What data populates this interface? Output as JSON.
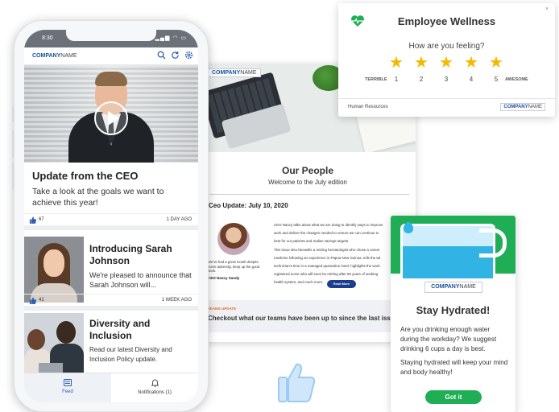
{
  "brand": {
    "logo_bold": "COMPANY",
    "logo_light": "NAME"
  },
  "phone": {
    "status_time": "8:30",
    "status_icons": "▂▄▆ ◠ ▭",
    "feed": [
      {
        "title": "Update from the CEO",
        "subtitle": "Take a look at the goals we want to achieve this year!",
        "likes": "67",
        "ago": "1 DAY AGO"
      },
      {
        "title": "Introducing Sarah Johnson",
        "subtitle": "We're pleased to announce that Sarah Johnson will...",
        "likes": "41",
        "ago": "1 WEEK AGO"
      },
      {
        "title": "Diversity and Inclusion",
        "subtitle": "Read our latest Diversity and Inclusion Policy update."
      }
    ],
    "tabs": {
      "feed": "Feed",
      "notifications": "Notifications (1)"
    }
  },
  "newsletter": {
    "title": "Our People",
    "subtitle": "Welcome to the July edition",
    "date": "Ceo Update: July 10, 2020",
    "quote": "We've had a great month despite some adversity, keep up the good work.",
    "ceo": "CEO Nancy Sandy",
    "body": [
      "CEO Nancy talks about what we are doing to identify ways to improve",
      "work and deliver the changes needed to ensure we can continue to",
      "best for our patients and realise savings targets.",
      "This issue also farewells a retiring hematologist who chose a career",
      "medicine following an experience in Papua New Guinea, tells the tal",
      "technician's time in a managed quarantine hotel, highlights the work",
      "registered nurse who will soon be retiring after 50 years of working",
      "health system, and much more."
    ],
    "read_more": "Read More",
    "team_label": "TEAMS UPDATE",
    "team_text": "Checkout what our teams have been up to since the last issue"
  },
  "wellness": {
    "title": "Employee Wellness",
    "close": "×",
    "question": "How are you feeling?",
    "rating_scale": [
      1,
      2,
      3,
      4,
      5
    ],
    "low_label": "TERRIBLE",
    "high_label": "AWESOME",
    "footer_left": "Human Resources"
  },
  "hydration": {
    "title": "Stay Hydrated!",
    "text1": "Are you drinking enough water during the workday? We suggest drinking 6 cups a day is best.",
    "text2": "Staying hydrated will keep your mind and body healthy!",
    "button": "Got it"
  },
  "colors": {
    "brand_blue": "#1a4f9c",
    "accent_green": "#1fae56",
    "star": "#f5b800",
    "water": "#31b3e4"
  },
  "icons": [
    "search-icon",
    "refresh-icon",
    "settings-icon",
    "play-icon",
    "thumbs-up-icon",
    "feed-icon",
    "bell-icon",
    "heartbeat-icon",
    "star-icon"
  ]
}
